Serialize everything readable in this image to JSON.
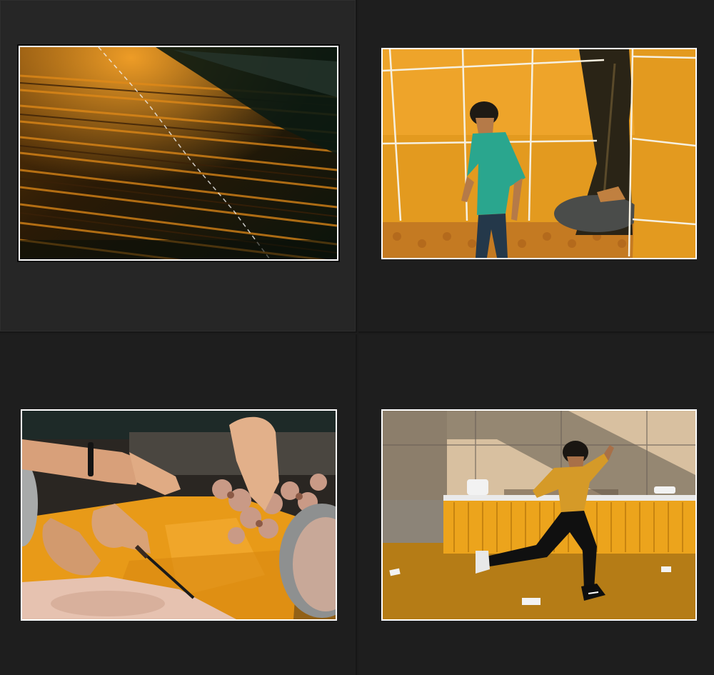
{
  "view": "grid",
  "selected_index": 0,
  "accent": "#f0a020",
  "background": "#1c1c1c",
  "thumbnails": [
    {
      "id": "thumb-1",
      "selected": true
    },
    {
      "id": "thumb-2",
      "selected": false
    },
    {
      "id": "thumb-3",
      "selected": false
    },
    {
      "id": "thumb-4",
      "selected": false
    }
  ]
}
